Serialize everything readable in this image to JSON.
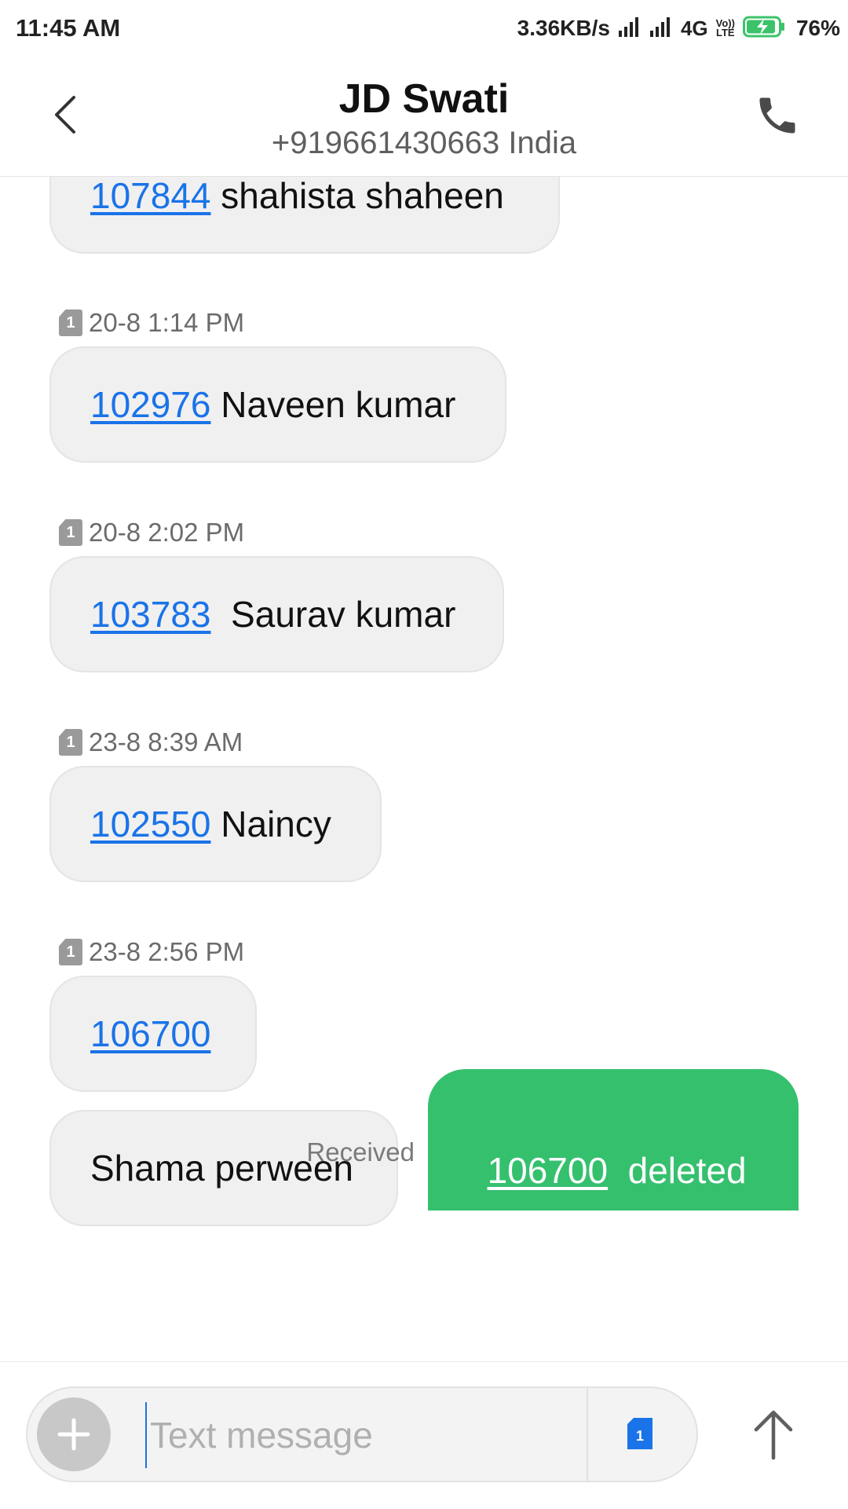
{
  "status_bar": {
    "time": "11:45 AM",
    "speed": "3.36KB/s",
    "network": "4G",
    "volte": "Vo)) LTE",
    "battery": "76%"
  },
  "header": {
    "contact_name": "JD Swati",
    "contact_number": "+919661430663 India",
    "icons": {
      "back": "chevron-left-icon",
      "call": "phone-icon"
    }
  },
  "messages": [
    {
      "number": "107844",
      "text": " shahista shaheen"
    },
    {
      "timestamp": "20-8 1:14 PM",
      "sim": "1",
      "number": "102976",
      "text": " Naveen kumar"
    },
    {
      "timestamp": "20-8 2:02 PM",
      "sim": "1",
      "number": "103783",
      "text": "  Saurav kumar"
    },
    {
      "timestamp": "23-8 8:39 AM",
      "sim": "1",
      "number": "102550",
      "text": " Naincy"
    },
    {
      "timestamp": "23-8 2:56 PM",
      "sim": "1",
      "number": "106700",
      "text": ""
    },
    {
      "text": "Shama perween"
    }
  ],
  "sent": {
    "number": "106700",
    "text": "  deleted",
    "status": "Received"
  },
  "composer": {
    "placeholder": "Text message",
    "sim": "1",
    "icons": {
      "add": "plus-icon",
      "send": "arrow-up-icon"
    }
  },
  "colors": {
    "link": "#1a73e8",
    "sent_bubble": "#35c06e",
    "received_bubble": "#f0f0f0",
    "battery_charging": "#3cc36a"
  }
}
